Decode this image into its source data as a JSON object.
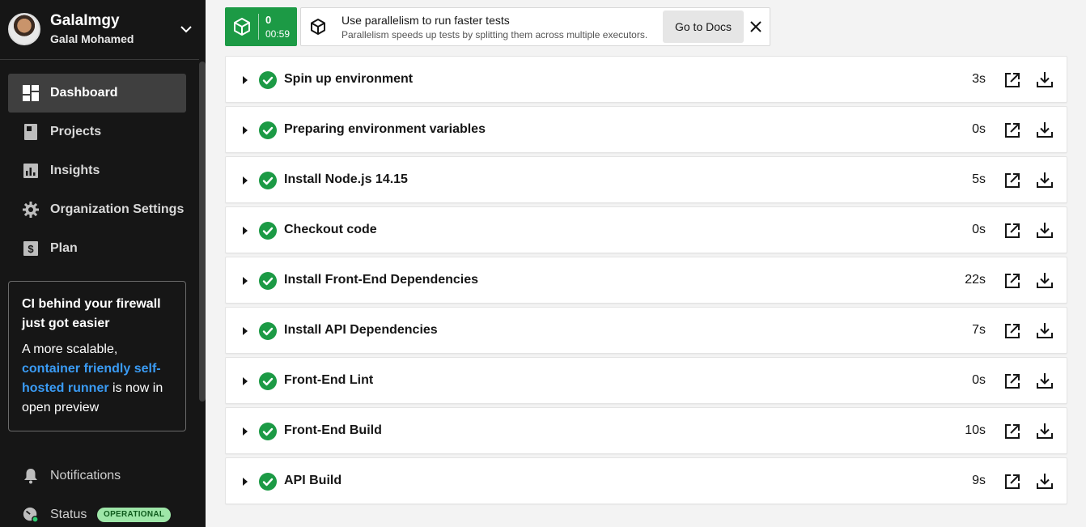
{
  "user": {
    "org": "GalaImgy",
    "name": "Galal Mohamed"
  },
  "nav": [
    {
      "label": "Dashboard",
      "icon": "dashboard-icon"
    },
    {
      "label": "Projects",
      "icon": "book-icon"
    },
    {
      "label": "Insights",
      "icon": "bar-chart-icon"
    },
    {
      "label": "Organization Settings",
      "icon": "gear-icon"
    },
    {
      "label": "Plan",
      "icon": "dollar-icon"
    }
  ],
  "promo": {
    "title": "CI behind your firewall just got easier",
    "body_start": "A more scalable, ",
    "link": "container friendly self-hosted runner",
    "body_end": " is now in open preview"
  },
  "notifications_label": "Notifications",
  "status": {
    "label": "Status",
    "badge": "OPERATIONAL"
  },
  "timer": {
    "count": "0",
    "time": "00:59"
  },
  "banner": {
    "title": "Use parallelism to run faster tests",
    "subtitle": "Parallelism speeds up tests by splitting them across multiple executors.",
    "button": "Go to Docs"
  },
  "steps": [
    {
      "name": "Spin up environment",
      "duration": "3s"
    },
    {
      "name": "Preparing environment variables",
      "duration": "0s"
    },
    {
      "name": "Install Node.js 14.15",
      "duration": "5s"
    },
    {
      "name": "Checkout code",
      "duration": "0s"
    },
    {
      "name": "Install Front-End Dependencies",
      "duration": "22s"
    },
    {
      "name": "Install API Dependencies",
      "duration": "7s"
    },
    {
      "name": "Front-End Lint",
      "duration": "0s"
    },
    {
      "name": "Front-End Build",
      "duration": "10s"
    },
    {
      "name": "API Build",
      "duration": "9s"
    }
  ],
  "colors": {
    "success": "#1c9a45",
    "sidebar": "#161616",
    "link": "#3a9bf4",
    "badge": "#9ee6a8"
  }
}
